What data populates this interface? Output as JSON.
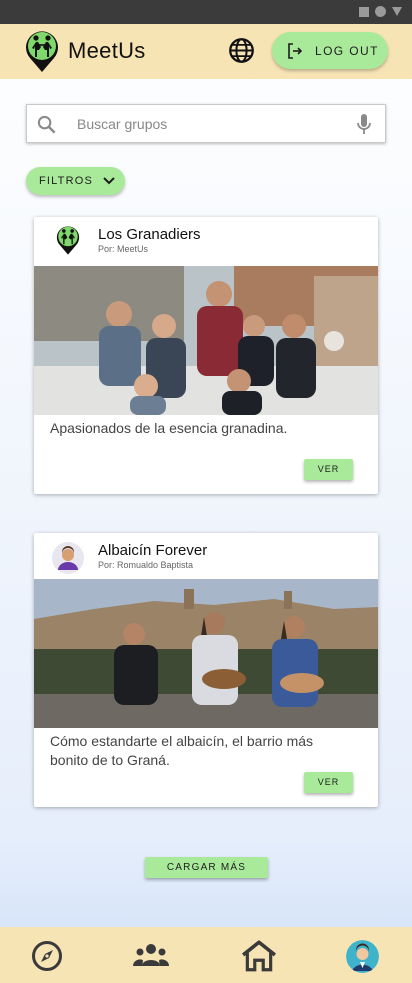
{
  "app": {
    "title": "MeetUs"
  },
  "header": {
    "logout_label": "LOG OUT"
  },
  "search": {
    "placeholder": "Buscar grupos",
    "value": ""
  },
  "filters": {
    "label": "FILTROS"
  },
  "groups": [
    {
      "title": "Los Granadiers",
      "author": "Por: MeetUs",
      "description": "Apasionados de la esencia granadina.",
      "button": "VER"
    },
    {
      "title": "Albaicín Forever",
      "author": "Por: Romualdo Baptista",
      "description": "Cómo estandarte el albaicín, el barrio más bonito de to Graná.",
      "button": "VER"
    }
  ],
  "load_more": "CARGAR MÁS",
  "bottom_nav": [
    {
      "icon": "compass-icon"
    },
    {
      "icon": "groups-icon"
    },
    {
      "icon": "home-icon"
    },
    {
      "icon": "profile-avatar"
    }
  ],
  "colors": {
    "appbar": "#f7e4b5",
    "button": "#a9ea9a",
    "logo_green": "#7ed86b"
  }
}
